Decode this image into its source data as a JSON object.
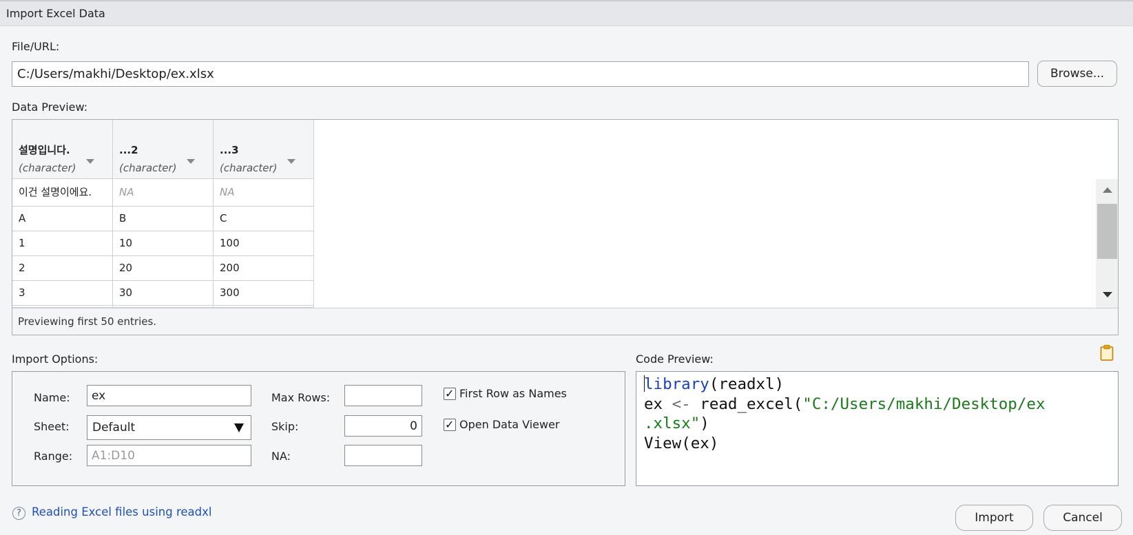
{
  "window": {
    "title": "Import Excel Data"
  },
  "file": {
    "label": "File/URL:",
    "value": "C:/Users/makhi/Desktop/ex.xlsx",
    "browse_label": "Browse..."
  },
  "preview": {
    "label": "Data Preview:",
    "columns": [
      {
        "name": "설명입니다.",
        "type": "(character)"
      },
      {
        "name": "...2",
        "type": "(character)"
      },
      {
        "name": "...3",
        "type": "(character)"
      }
    ],
    "rows": [
      [
        "이건 설명이에요.",
        "NA",
        "NA"
      ],
      [
        "A",
        "B",
        "C"
      ],
      [
        "1",
        "10",
        "100"
      ],
      [
        "2",
        "20",
        "200"
      ],
      [
        "3",
        "30",
        "300"
      ]
    ],
    "footer": "Previewing first 50 entries."
  },
  "options": {
    "label": "Import Options:",
    "name_label": "Name:",
    "name_value": "ex",
    "sheet_label": "Sheet:",
    "sheet_value": "Default",
    "range_label": "Range:",
    "range_placeholder": "A1:D10",
    "maxrows_label": "Max Rows:",
    "maxrows_value": "",
    "skip_label": "Skip:",
    "skip_value": "0",
    "na_label": "NA:",
    "na_value": "",
    "first_row_label": "First Row as Names",
    "first_row_checked": true,
    "open_viewer_label": "Open Data Viewer",
    "open_viewer_checked": true
  },
  "code": {
    "label": "Code Preview:",
    "fn1": "library",
    "arg1": "readxl",
    "var": "ex",
    "assign": "<-",
    "fn2": "read_excel",
    "str_a": "\"C:/Users/makhi/Desktop/ex",
    "str_b": ".xlsx\"",
    "fn3": "View",
    "arg3": "ex"
  },
  "footer": {
    "help_icon": "?",
    "help_link": "Reading Excel files using readxl",
    "import_label": "Import",
    "cancel_label": "Cancel"
  },
  "colors": {
    "accent_link": "#1d4fb8",
    "code_keyword": "#1a3fc6",
    "code_string": "#1a7a1a"
  }
}
